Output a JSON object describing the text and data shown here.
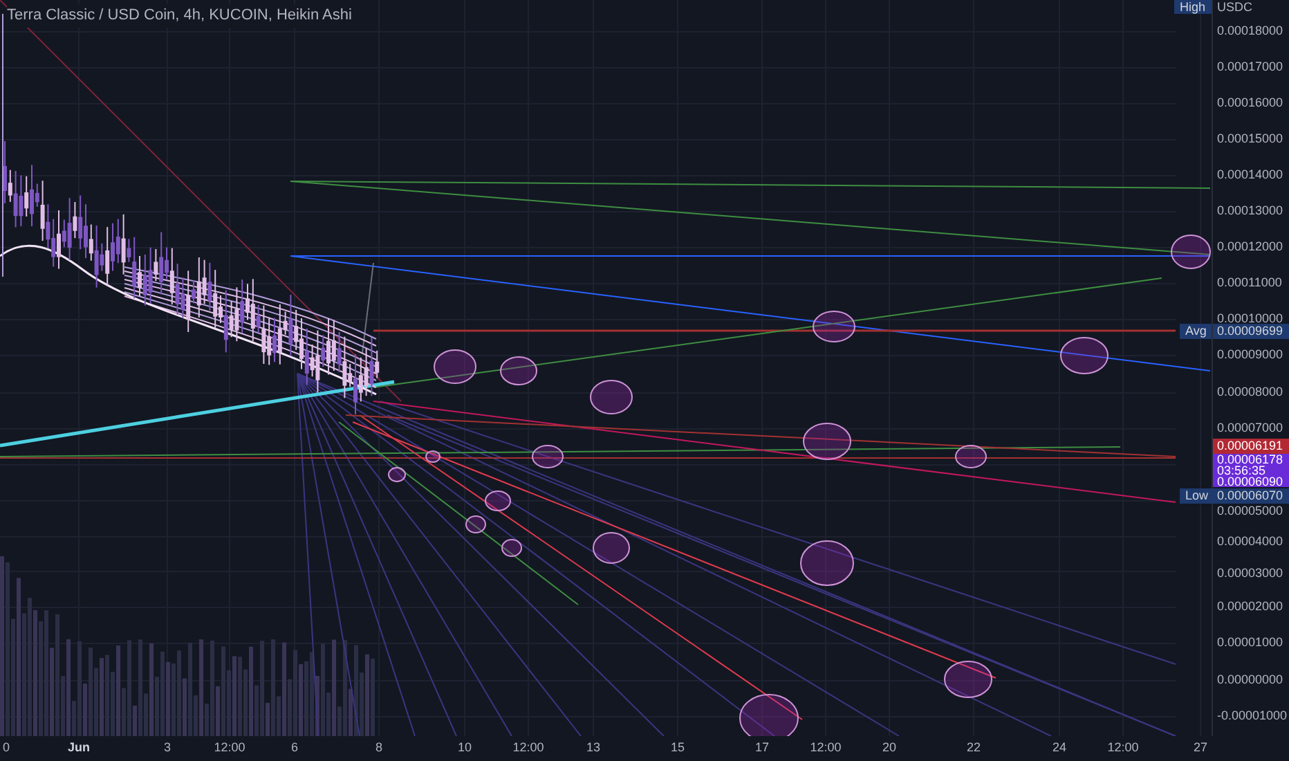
{
  "chart": {
    "title": "Terra Classic / USD Coin, 4h, KUCOIN, Heikin Ashi"
  },
  "price_axis": {
    "currency": "USDC",
    "high_label": "High",
    "labels": [
      "0.00018000",
      "0.00017000",
      "0.00016000",
      "0.00015000",
      "0.00014000",
      "0.00013000",
      "0.00012000",
      "0.00011000",
      "0.00010000",
      "0.00009000",
      "0.00008000",
      "0.00007000",
      "0.00005000",
      "0.00004000",
      "0.00003000",
      "0.00002000",
      "0.00001000",
      "0.00000000",
      "-0.00001000"
    ],
    "badges": [
      {
        "kind": "tagged",
        "tag": "Avg",
        "value": "0.00009699"
      },
      {
        "kind": "red",
        "value": "0.00006191"
      },
      {
        "kind": "purple",
        "lines": [
          "0.00006178",
          "03:56:35",
          "0.00006090"
        ]
      },
      {
        "kind": "tagged",
        "tag": "Low",
        "value": "0.00006070"
      }
    ]
  },
  "time_axis": {
    "labels": [
      "0",
      "Jun",
      "3",
      "12:00",
      "6",
      "8",
      "10",
      "12:00",
      "13",
      "15",
      "17",
      "12:00",
      "20",
      "22",
      "24",
      "12:00",
      "27"
    ]
  }
}
